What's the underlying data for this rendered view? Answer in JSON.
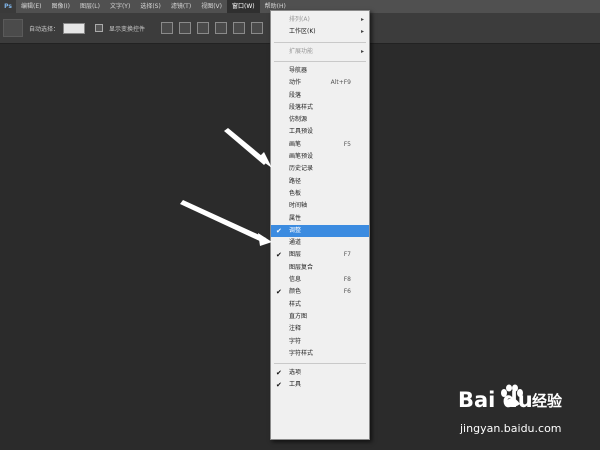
{
  "menubar": {
    "logo": "Ps",
    "items": [
      "编辑(E)",
      "图像(I)",
      "图层(L)",
      "文字(Y)",
      "选择(S)",
      "滤镜(T)",
      "视图(V)",
      "窗口(W)",
      "帮助(H)"
    ],
    "active_index": 7
  },
  "options_bar": {
    "auto_select_label": "自动选择：",
    "show_transform_label": "显示变换控件"
  },
  "window_menu": {
    "items": [
      {
        "label": "排列(A)",
        "submenu": true,
        "disabled": true
      },
      {
        "label": "工作区(K)",
        "submenu": true
      },
      {
        "separator": true
      },
      {
        "label": "扩展功能",
        "submenu": true,
        "disabled": true
      },
      {
        "separator": true
      },
      {
        "label": "导航器"
      },
      {
        "label": "动作",
        "shortcut": "Alt+F9"
      },
      {
        "label": "段落"
      },
      {
        "label": "段落样式"
      },
      {
        "label": "仿制源"
      },
      {
        "label": "工具预设"
      },
      {
        "label": "画笔",
        "shortcut": "F5"
      },
      {
        "label": "画笔预设"
      },
      {
        "label": "历史记录"
      },
      {
        "label": "路径"
      },
      {
        "label": "色板"
      },
      {
        "label": "时间轴"
      },
      {
        "label": "属性"
      },
      {
        "label": "调整",
        "checked": true,
        "highlighted": true
      },
      {
        "label": "通道"
      },
      {
        "label": "图层",
        "shortcut": "F7",
        "checked": true
      },
      {
        "label": "图层复合"
      },
      {
        "label": "信息",
        "shortcut": "F8"
      },
      {
        "label": "颜色",
        "shortcut": "F6",
        "checked": true
      },
      {
        "label": "样式"
      },
      {
        "label": "直方图"
      },
      {
        "label": "注释"
      },
      {
        "label": "字符"
      },
      {
        "label": "字符样式"
      },
      {
        "separator": true
      },
      {
        "label": "选项",
        "checked": true
      },
      {
        "label": "工具",
        "checked": true
      }
    ]
  },
  "watermark": {
    "brand": "Bai du",
    "product": "经验",
    "url": "jingyan.baidu.com"
  },
  "colors": {
    "highlight": "#3b8be0",
    "canvas": "#2b2b2b",
    "menu_bg": "#f0f0f0"
  }
}
